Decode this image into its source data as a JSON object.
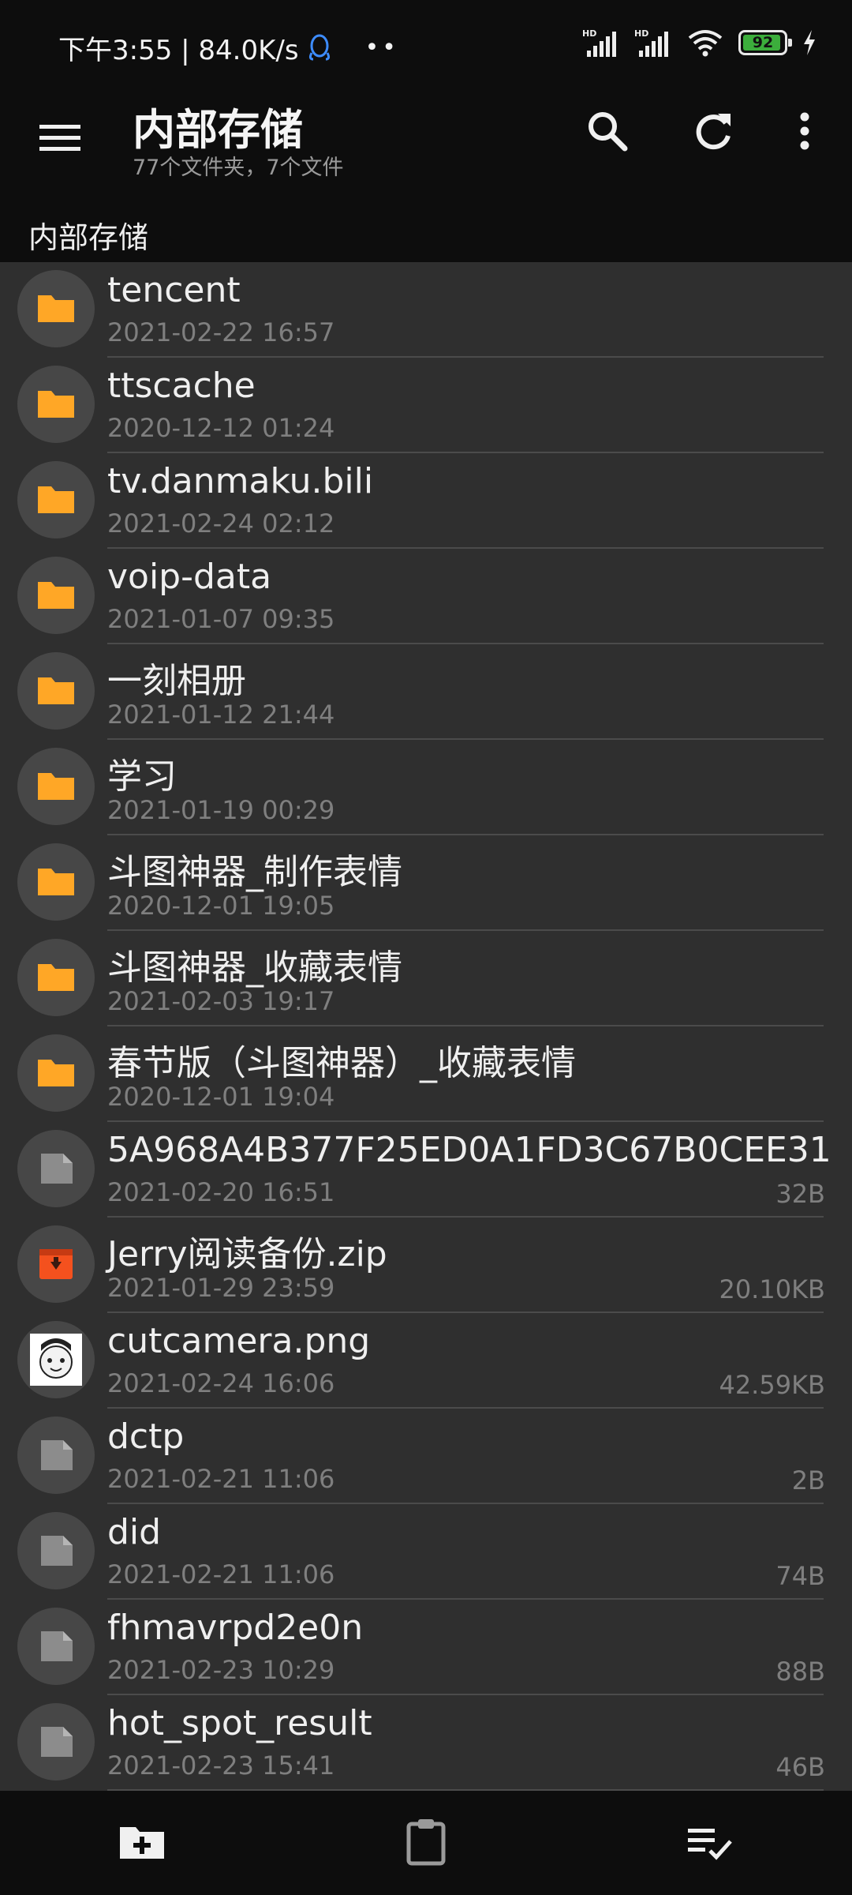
{
  "status_bar": {
    "time_speed": "下午3:55 | 84.0K/s",
    "dots": "••",
    "battery": "92"
  },
  "toolbar": {
    "title": "内部存储",
    "subtitle": "77个文件夹，7个文件",
    "breadcrumb": "内部存储"
  },
  "colors": {
    "folder": "#ffa726",
    "file": "#8c8c8c",
    "archive": "#f4511e",
    "background": "#2f2f2f",
    "bar": "#0d0d0d"
  },
  "files": [
    {
      "name": "tencent",
      "date": "2021-02-22 16:57",
      "size": "",
      "type": "folder"
    },
    {
      "name": "ttscache",
      "date": "2020-12-12 01:24",
      "size": "",
      "type": "folder"
    },
    {
      "name": "tv.danmaku.bili",
      "date": "2021-02-24 02:12",
      "size": "",
      "type": "folder"
    },
    {
      "name": "voip-data",
      "date": "2021-01-07 09:35",
      "size": "",
      "type": "folder"
    },
    {
      "name": "一刻相册",
      "date": "2021-01-12 21:44",
      "size": "",
      "type": "folder"
    },
    {
      "name": "学习",
      "date": "2021-01-19 00:29",
      "size": "",
      "type": "folder"
    },
    {
      "name": "斗图神器_制作表情",
      "date": "2020-12-01 19:05",
      "size": "",
      "type": "folder"
    },
    {
      "name": "斗图神器_收藏表情",
      "date": "2021-02-03 19:17",
      "size": "",
      "type": "folder"
    },
    {
      "name": "春节版（斗图神器）_收藏表情",
      "date": "2020-12-01 19:04",
      "size": "",
      "type": "folder"
    },
    {
      "name": "5A968A4B377F25ED0A1FD3C67B0CEE31",
      "date": "2021-02-20 16:51",
      "size": "32B",
      "type": "file"
    },
    {
      "name": "Jerry阅读备份.zip",
      "date": "2021-01-29 23:59",
      "size": "20.10KB",
      "type": "archive"
    },
    {
      "name": "cutcamera.png",
      "date": "2021-02-24 16:06",
      "size": "42.59KB",
      "type": "image"
    },
    {
      "name": "dctp",
      "date": "2021-02-21 11:06",
      "size": "2B",
      "type": "file"
    },
    {
      "name": "did",
      "date": "2021-02-21 11:06",
      "size": "74B",
      "type": "file"
    },
    {
      "name": "fhmavrpd2e0n",
      "date": "2021-02-23 10:29",
      "size": "88B",
      "type": "file"
    },
    {
      "name": "hot_spot_result",
      "date": "2021-02-23 15:41",
      "size": "46B",
      "type": "file"
    }
  ]
}
